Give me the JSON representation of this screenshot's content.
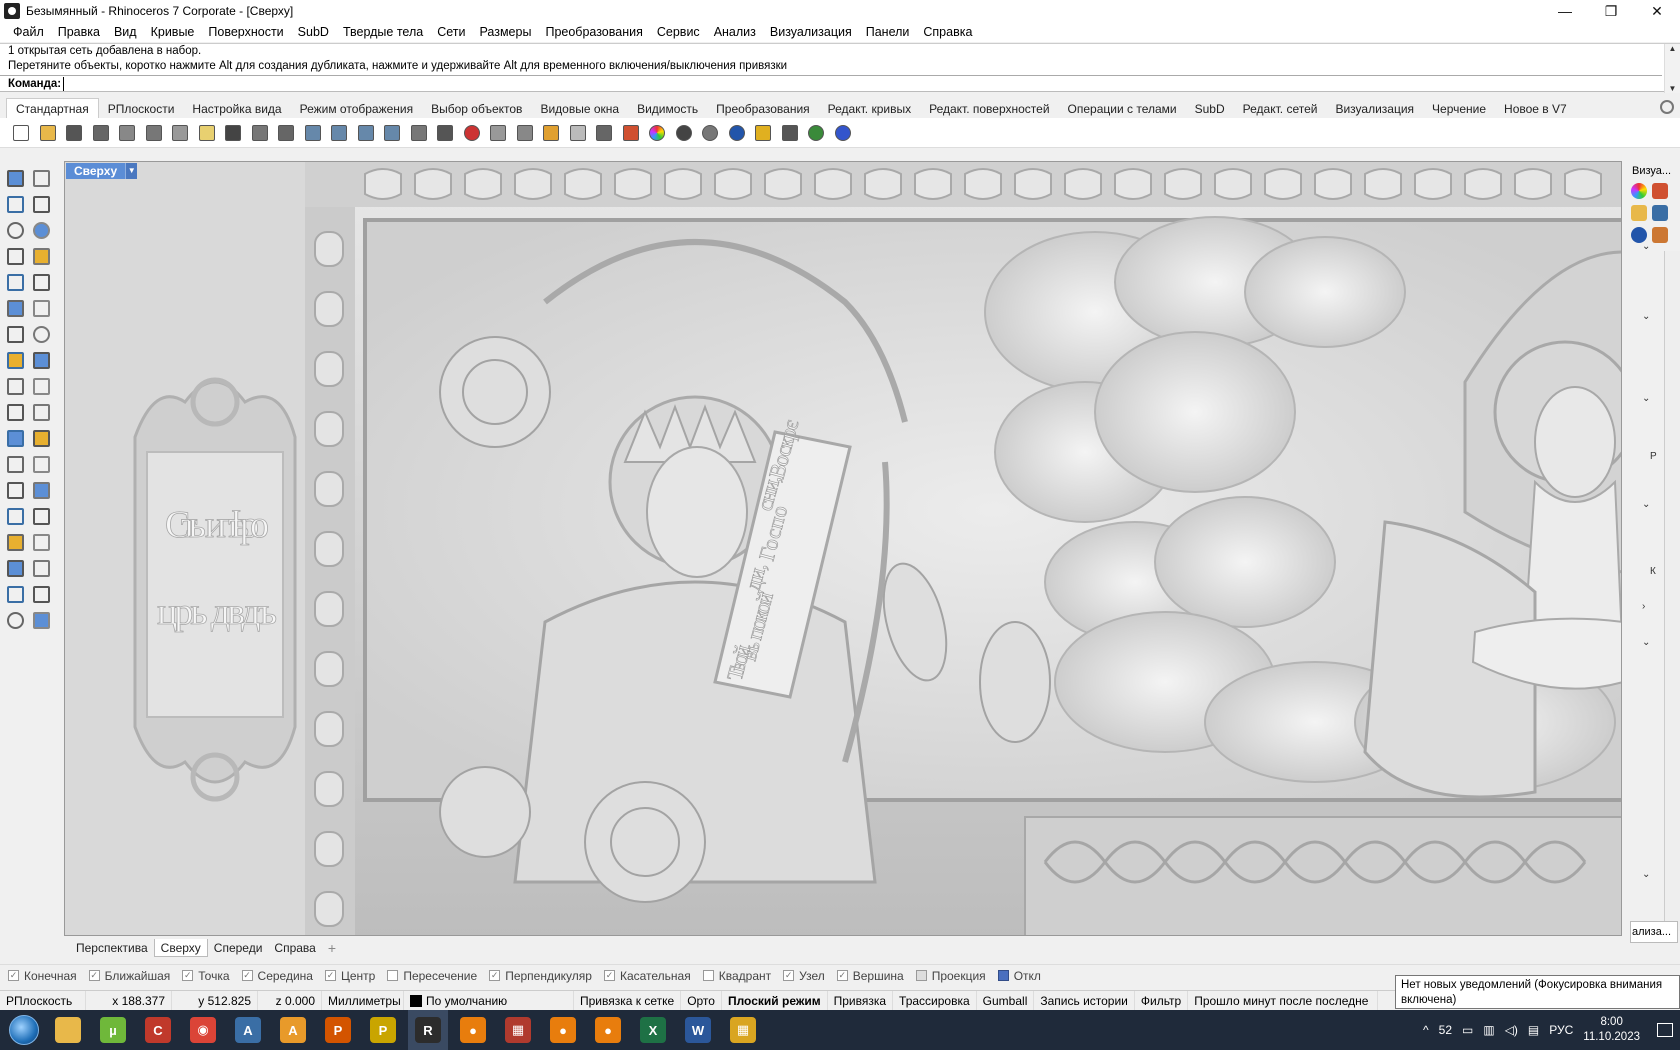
{
  "window": {
    "title": "Безымянный - Rhinoceros 7 Corporate - [Сверху]",
    "controls": [
      "—",
      "❐",
      "✕"
    ]
  },
  "menu": [
    "Файл",
    "Правка",
    "Вид",
    "Кривые",
    "Поверхности",
    "SubD",
    "Твердые тела",
    "Сети",
    "Размеры",
    "Преобразования",
    "Сервис",
    "Анализ",
    "Визуализация",
    "Панели",
    "Справка"
  ],
  "command": {
    "history_line1": "1 открытая сеть добавлена в набор.",
    "history_line2": "Перетяните объекты, коротко нажмите Alt для создания дубликата, нажмите и удерживайте Alt для временного включения/выключения привязки",
    "prompt_label": "Команда:",
    "input_value": ""
  },
  "toolbar_tabs": [
    "Стандартная",
    "РПлоскости",
    "Настройка вида",
    "Режим отображения",
    "Выбор объектов",
    "Видовые окна",
    "Видимость",
    "Преобразования",
    "Редакт. кривых",
    "Редакт. поверхностей",
    "Операции с телами",
    "SubD",
    "Редакт. сетей",
    "Визуализация",
    "Черчение",
    "Новое в V7"
  ],
  "toolbar_icons": [
    {
      "name": "new-file-icon",
      "color": "#ffffff"
    },
    {
      "name": "open-folder-icon",
      "color": "#e8b84a"
    },
    {
      "name": "save-icon",
      "color": "#555555"
    },
    {
      "name": "print-icon",
      "color": "#666666"
    },
    {
      "name": "import-icon",
      "color": "#888888"
    },
    {
      "name": "cut-icon",
      "color": "#777777"
    },
    {
      "name": "copy-icon",
      "color": "#999999"
    },
    {
      "name": "paste-icon",
      "color": "#e8d070"
    },
    {
      "name": "undo-icon",
      "color": "#444444"
    },
    {
      "name": "pan-hand-icon",
      "color": "#777777"
    },
    {
      "name": "rotate-view-icon",
      "color": "#666666"
    },
    {
      "name": "zoom-icon",
      "color": "#6688aa"
    },
    {
      "name": "zoom-window-icon",
      "color": "#6688aa"
    },
    {
      "name": "zoom-extents-icon",
      "color": "#6688aa"
    },
    {
      "name": "zoom-selected-icon",
      "color": "#6688aa"
    },
    {
      "name": "undo-view-icon",
      "color": "#777777"
    },
    {
      "name": "four-viewports-icon",
      "color": "#555555"
    },
    {
      "name": "car-render-icon",
      "color": "#cc3333"
    },
    {
      "name": "grid-snap-icon",
      "color": "#999999"
    },
    {
      "name": "cplane-icon",
      "color": "#888888"
    },
    {
      "name": "object-properties-icon",
      "color": "#e0a030"
    },
    {
      "name": "light-bulb-icon",
      "color": "#bbbbbb"
    },
    {
      "name": "lock-icon",
      "color": "#666666"
    },
    {
      "name": "layers-icon",
      "color": "#d05030"
    },
    {
      "name": "color-wheel-icon",
      "color": "#e04060"
    },
    {
      "name": "shaded-sphere-icon",
      "color": "#444444"
    },
    {
      "name": "rendered-sphere-icon",
      "color": "#777777"
    },
    {
      "name": "render-icon",
      "color": "#2255aa"
    },
    {
      "name": "flag-icon",
      "color": "#e0b020"
    },
    {
      "name": "dimension-icon",
      "color": "#555555"
    },
    {
      "name": "options-icon",
      "color": "#3a8a3a"
    },
    {
      "name": "help-icon",
      "color": "#3355cc"
    }
  ],
  "left_icons": [
    "select-arrow-icon",
    "point-icon",
    "polyline-icon",
    "curve-icon",
    "circle-icon",
    "ellipse-icon",
    "polygon-icon",
    "rectangle-icon",
    "arc-icon",
    "fillet-icon",
    "surface-icon",
    "loft-icon",
    "box-solid-icon",
    "boolean-icon",
    "extrude-icon",
    "plane-icon",
    "explode-icon",
    "arrow-icon",
    "split-icon",
    "trim-icon",
    "group-icon",
    "ungroup-icon",
    "rebuild-icon",
    "offset-icon",
    "text-icon",
    "scale-icon",
    "array-icon",
    "align-icon",
    "block-icon",
    "measure-icon",
    "grid-array-icon",
    "distribute-icon",
    "box-edit-icon",
    "check-icon",
    "analyze-icon",
    "material-icon"
  ],
  "viewport": {
    "name": "Сверху",
    "dropdown": "▼",
    "tabs": [
      "Перспектива",
      "Сверху",
      "Спереди",
      "Справа"
    ],
    "active_tab": "Сверху",
    "add_tab": "+",
    "inscription_line1": "Стыи пѣро",
    "inscription_line2": "црь двдъ",
    "scroll_text_line1": "Воскрє",
    "scroll_text_line2": "сни,",
    "scroll_text_line3": "Госпо",
    "scroll_text_line4": "ди,",
    "scroll_text_line5": "въ покой",
    "scroll_text_line6": "Твой"
  },
  "right_panel": {
    "title": "Визуа...",
    "letters": [
      "Р",
      "К"
    ],
    "chevrons": [
      "⌄",
      "⌄",
      "⌄",
      "⌄",
      "›",
      "⌄",
      "⌄"
    ],
    "bottom_tab": "ализа..."
  },
  "osnaps": [
    {
      "label": "Конечная",
      "checked": true
    },
    {
      "label": "Ближайшая",
      "checked": true
    },
    {
      "label": "Точка",
      "checked": true
    },
    {
      "label": "Середина",
      "checked": true
    },
    {
      "label": "Центр",
      "checked": true
    },
    {
      "label": "Пересечение",
      "checked": false
    },
    {
      "label": "Перпендикуляр",
      "checked": true
    },
    {
      "label": "Касательная",
      "checked": true
    },
    {
      "label": "Квадрант",
      "checked": false
    },
    {
      "label": "Узел",
      "checked": true
    },
    {
      "label": "Вершина",
      "checked": true
    },
    {
      "label": "Проекция",
      "checked": false
    },
    {
      "label": "Откл",
      "checked": true
    }
  ],
  "status": {
    "cplane": "РПлоскость",
    "x": "x 188.377",
    "y": "y 512.825",
    "z": "z 0.000",
    "units": "Миллиметры",
    "layer": "По умолчанию",
    "grid_snap": "Привязка к сетке",
    "ortho": "Орто",
    "planar": "Плоский режим",
    "osnap": "Привязка",
    "smarttrack": "Трассировка",
    "gumball": "Gumball",
    "history": "Запись истории",
    "filter": "Фильтр",
    "autosave": "Прошло минут после последне"
  },
  "tooltip": {
    "line1": "Нет новых уведомлений (Фокусировка внимания",
    "line2": "включена)"
  },
  "taskbar": {
    "apps": [
      {
        "name": "explorer-icon",
        "color": "#e8b84a",
        "label": ""
      },
      {
        "name": "utorrent-icon",
        "color": "#6fb83a",
        "label": "µ"
      },
      {
        "name": "ccleaner-icon",
        "color": "#c0392b",
        "label": "C"
      },
      {
        "name": "chrome-icon",
        "color": "#db4437",
        "label": "◉"
      },
      {
        "name": "autodesk-icon",
        "color": "#3a6ea5",
        "label": "A"
      },
      {
        "name": "app-a-icon",
        "color": "#e89a2a",
        "label": "A"
      },
      {
        "name": "app-p-icon",
        "color": "#d35400",
        "label": "P"
      },
      {
        "name": "app-p2-icon",
        "color": "#c9a500",
        "label": "P"
      },
      {
        "name": "rhino-icon",
        "color": "#2c2c2c",
        "label": "R"
      },
      {
        "name": "blender-icon",
        "color": "#e87d0d",
        "label": "●"
      },
      {
        "name": "calendar-app-icon",
        "color": "#b03a2e",
        "label": "▦"
      },
      {
        "name": "blender2-icon",
        "color": "#e87d0d",
        "label": "●"
      },
      {
        "name": "blender3-icon",
        "color": "#e87d0d",
        "label": "●"
      },
      {
        "name": "excel-icon",
        "color": "#1e7145",
        "label": "X"
      },
      {
        "name": "word-icon",
        "color": "#2b579a",
        "label": "W"
      },
      {
        "name": "grid-app-icon",
        "color": "#d9a521",
        "label": "▦"
      }
    ],
    "active_app": "rhino-icon",
    "tray_up": "^",
    "tray_number": "52",
    "tray_lang": "РУС",
    "time": "8:00",
    "date": "11.10.2023"
  }
}
